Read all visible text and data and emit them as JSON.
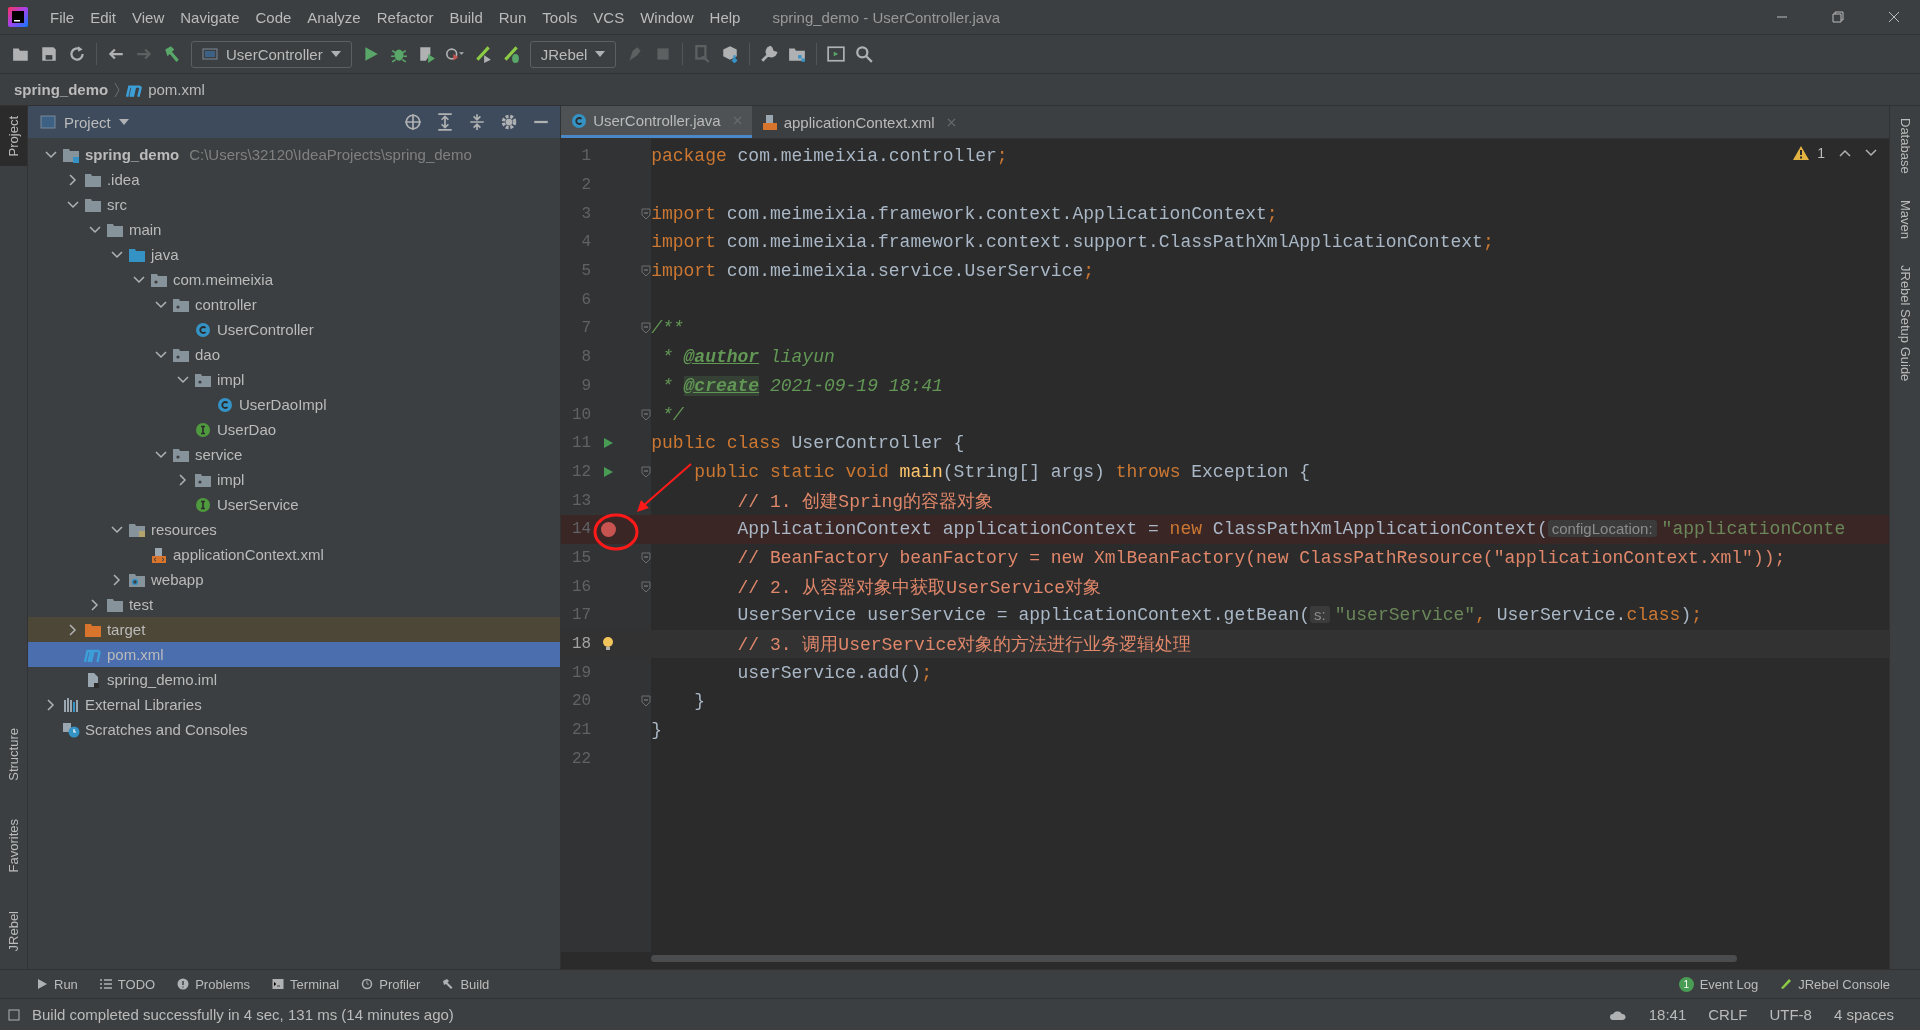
{
  "window": {
    "title": "spring_demo - UserController.java"
  },
  "menu": [
    "File",
    "Edit",
    "View",
    "Navigate",
    "Code",
    "Analyze",
    "Refactor",
    "Build",
    "Run",
    "Tools",
    "VCS",
    "Window",
    "Help"
  ],
  "toolbar": {
    "run_configuration": "UserController",
    "jrebel_dropdown": "JRebel"
  },
  "breadcrumb": [
    {
      "label": "spring_demo",
      "kind": "project"
    },
    {
      "label": "pom.xml",
      "kind": "maven"
    }
  ],
  "left_tool_windows": [
    {
      "label": "Project",
      "selected": true
    },
    {
      "label": "Structure",
      "selected": false
    },
    {
      "label": "Favorites",
      "selected": false
    },
    {
      "label": "JRebel",
      "selected": false
    }
  ],
  "right_tool_windows": [
    "Database",
    "Maven",
    "JRebel Setup Guide"
  ],
  "project": {
    "title": "Project",
    "tree": [
      {
        "label": "spring_demo",
        "path": "C:\\Users\\32120\\IdeaProjects\\spring_demo",
        "kind": "module",
        "expanded": true,
        "selected": false,
        "children": [
          {
            "label": ".idea",
            "kind": "folder",
            "expanded": false,
            "selected": false
          },
          {
            "label": "src",
            "kind": "folder",
            "expanded": true,
            "selected": false,
            "children": [
              {
                "label": "main",
                "kind": "folder",
                "expanded": true,
                "selected": false,
                "children": [
                  {
                    "label": "java",
                    "kind": "source-folder",
                    "expanded": true,
                    "selected": false,
                    "children": [
                      {
                        "label": "com.meimeixia",
                        "kind": "package",
                        "expanded": true,
                        "selected": false,
                        "children": [
                          {
                            "label": "controller",
                            "kind": "package",
                            "expanded": true,
                            "selected": false,
                            "children": [
                              {
                                "label": "UserController",
                                "kind": "class",
                                "selected": false
                              }
                            ]
                          },
                          {
                            "label": "dao",
                            "kind": "package",
                            "expanded": true,
                            "selected": false,
                            "children": [
                              {
                                "label": "impl",
                                "kind": "package",
                                "expanded": true,
                                "selected": false,
                                "children": [
                                  {
                                    "label": "UserDaoImpl",
                                    "kind": "class",
                                    "selected": false
                                  }
                                ]
                              },
                              {
                                "label": "UserDao",
                                "kind": "interface",
                                "selected": false
                              }
                            ]
                          },
                          {
                            "label": "service",
                            "kind": "package",
                            "expanded": true,
                            "selected": false,
                            "children": [
                              {
                                "label": "impl",
                                "kind": "package",
                                "expanded": false,
                                "selected": false
                              },
                              {
                                "label": "UserService",
                                "kind": "interface",
                                "selected": false
                              }
                            ]
                          }
                        ]
                      }
                    ]
                  },
                  {
                    "label": "resources",
                    "kind": "resources-folder",
                    "expanded": true,
                    "selected": false,
                    "children": [
                      {
                        "label": "applicationContext.xml",
                        "kind": "xml",
                        "selected": false
                      }
                    ]
                  },
                  {
                    "label": "webapp",
                    "kind": "web-folder",
                    "expanded": false,
                    "selected": false
                  }
                ]
              },
              {
                "label": "test",
                "kind": "folder",
                "expanded": false,
                "selected": false
              }
            ]
          },
          {
            "label": "target",
            "kind": "excluded-folder",
            "expanded": false,
            "selected": false
          },
          {
            "label": "pom.xml",
            "kind": "maven",
            "selected": true
          },
          {
            "label": "spring_demo.iml",
            "kind": "iml",
            "selected": false
          }
        ]
      },
      {
        "label": "External Libraries",
        "kind": "libraries",
        "expanded": false,
        "selected": false
      },
      {
        "label": "Scratches and Consoles",
        "kind": "scratches",
        "selected": false
      }
    ]
  },
  "tabs": [
    {
      "label": "UserController.java",
      "kind": "class",
      "selected": true
    },
    {
      "label": "applicationContext.xml",
      "kind": "xml",
      "selected": false
    }
  ],
  "editor": {
    "warnings": "1",
    "lines": [
      {
        "number": "1",
        "tokens": [
          {
            "text": "package ",
            "kind": "kw"
          },
          {
            "text": "com.meimeixia.controller",
            "kind": "plain"
          },
          {
            "text": ";",
            "kind": "kw"
          }
        ]
      },
      {
        "number": "2"
      },
      {
        "number": "3",
        "fold": true,
        "tokens": [
          {
            "text": "import ",
            "kind": "kw"
          },
          {
            "text": "com.meimeixia.framework.context.ApplicationContext",
            "kind": "plain"
          },
          {
            "text": ";",
            "kind": "kw"
          }
        ]
      },
      {
        "number": "4",
        "tokens": [
          {
            "text": "import ",
            "kind": "kw"
          },
          {
            "text": "com.meimeixia.framework.context.support.ClassPathXmlApplicationContext",
            "kind": "plain"
          },
          {
            "text": ";",
            "kind": "kw"
          }
        ]
      },
      {
        "number": "5",
        "fold": true,
        "tokens": [
          {
            "text": "import ",
            "kind": "kw"
          },
          {
            "text": "com.meimeixia.service.UserService",
            "kind": "plain"
          },
          {
            "text": ";",
            "kind": "kw"
          }
        ]
      },
      {
        "number": "6"
      },
      {
        "number": "7",
        "fold": true,
        "tokens": [
          {
            "text": "/**",
            "kind": "doc"
          }
        ]
      },
      {
        "number": "8",
        "tokens": [
          {
            "text": " * ",
            "kind": "doc"
          },
          {
            "text": "@author",
            "kind": "doctag"
          },
          {
            "text": " liayun",
            "kind": "doc"
          }
        ]
      },
      {
        "number": "9",
        "tokens": [
          {
            "text": " * ",
            "kind": "doc"
          },
          {
            "text": "@create",
            "kind": "doctag-marked"
          },
          {
            "text": " 2021-09-19 18:41",
            "kind": "doc"
          }
        ]
      },
      {
        "number": "10",
        "fold": true,
        "tokens": [
          {
            "text": " */",
            "kind": "doc"
          }
        ]
      },
      {
        "number": "11",
        "kind": "run",
        "tokens": [
          {
            "text": "public class ",
            "kind": "kw"
          },
          {
            "text": "UserController {",
            "kind": "plain"
          }
        ]
      },
      {
        "number": "12",
        "kind": "run",
        "fold": true,
        "tokens": [
          {
            "text": "    public static void ",
            "kind": "kw"
          },
          {
            "text": "main",
            "kind": "method"
          },
          {
            "text": "(String[] args) ",
            "kind": "plain"
          },
          {
            "text": "throws",
            "kind": "kw"
          },
          {
            "text": " Exception {",
            "kind": "plain"
          }
        ]
      },
      {
        "number": "13",
        "tokens": [
          {
            "text": "        // 1. 创建Spring的容器对象",
            "kind": "comment"
          }
        ]
      },
      {
        "number": "14",
        "kind": "breakpoint",
        "tokens": [
          {
            "text": "        ApplicationContext applicationContext = ",
            "kind": "plain"
          },
          {
            "text": "new ",
            "kind": "kw"
          },
          {
            "text": "ClassPathXmlApplicationContext(",
            "kind": "plain"
          },
          {
            "text": "configLocation:",
            "kind": "hint"
          },
          {
            "text": "\"applicationConte",
            "kind": "str"
          }
        ]
      },
      {
        "number": "15",
        "fold": true,
        "tokens": [
          {
            "text": "        // BeanFactory beanFactory = new XmlBeanFactory(new ClassPathResource(\"applicationContext.xml\"));",
            "kind": "comment"
          }
        ]
      },
      {
        "number": "16",
        "fold": true,
        "tokens": [
          {
            "text": "        // 2. 从容器对象中获取UserService对象",
            "kind": "comment"
          }
        ]
      },
      {
        "number": "17",
        "tokens": [
          {
            "text": "        UserService userService = applicationContext.getBean(",
            "kind": "plain"
          },
          {
            "text": "s:",
            "kind": "hint"
          },
          {
            "text": "\"userService\"",
            "kind": "str"
          },
          {
            "text": ", ",
            "kind": "kw"
          },
          {
            "text": "UserService.",
            "kind": "plain"
          },
          {
            "text": "class",
            "kind": "kw"
          },
          {
            "text": ")",
            "kind": "plain"
          },
          {
            "text": ";",
            "kind": "kw"
          }
        ]
      },
      {
        "number": "18",
        "kind": "bulb",
        "current": true,
        "tokens": [
          {
            "text": "        // 3. 调用UserService对象的方法进行业务逻辑处理",
            "kind": "comment"
          }
        ]
      },
      {
        "number": "19",
        "tokens": [
          {
            "text": "        userService.add()",
            "kind": "plain"
          },
          {
            "text": ";",
            "kind": "kw"
          }
        ]
      },
      {
        "number": "20",
        "fold": true,
        "tokens": [
          {
            "text": "    }",
            "kind": "plain"
          }
        ]
      },
      {
        "number": "21",
        "tokens": [
          {
            "text": "}",
            "kind": "plain"
          }
        ]
      },
      {
        "number": "22"
      }
    ]
  },
  "bottom_tools": [
    {
      "label": "Run",
      "kind": "run"
    },
    {
      "label": "TODO",
      "kind": "todo"
    },
    {
      "label": "Problems",
      "kind": "problems"
    },
    {
      "label": "Terminal",
      "kind": "terminal"
    },
    {
      "label": "Profiler",
      "kind": "profiler"
    },
    {
      "label": "Build",
      "kind": "build"
    }
  ],
  "bottom_tools_right": [
    {
      "label": "Event Log",
      "badge": "1"
    },
    {
      "label": "JRebel Console"
    }
  ],
  "status_bar": {
    "message": "Build completed successfully in 4 sec, 131 ms (14 minutes ago)",
    "items": [
      "18:41",
      "CRLF",
      "UTF-8",
      "4 spaces"
    ]
  }
}
